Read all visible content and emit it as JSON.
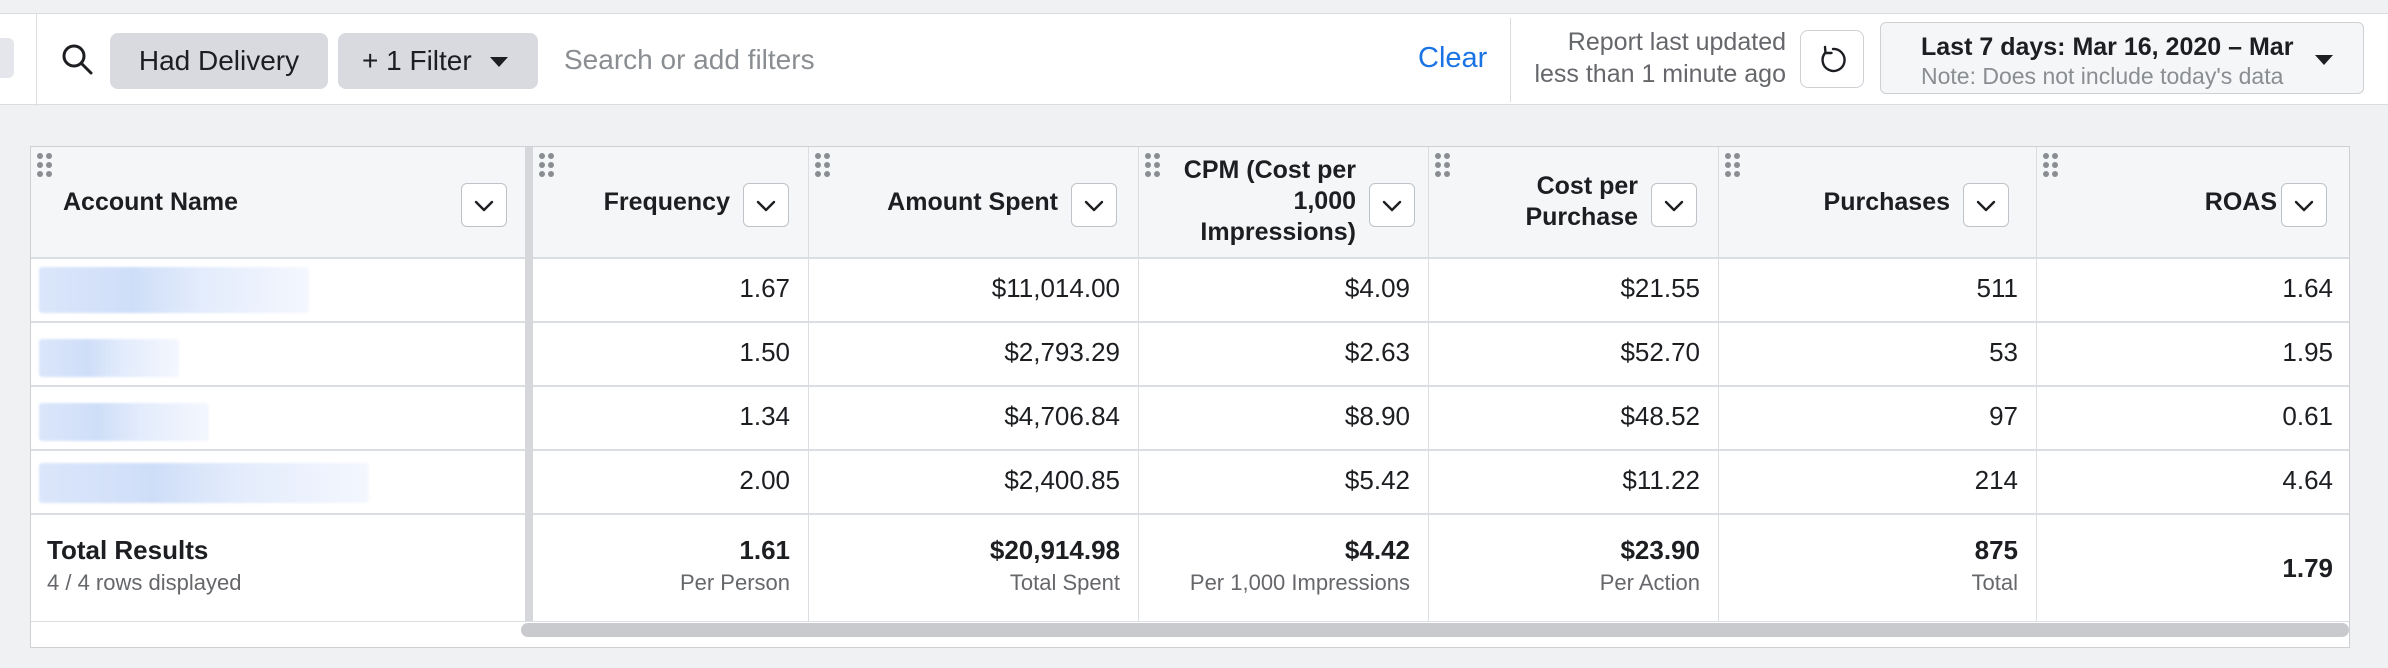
{
  "filterbar": {
    "chips": {
      "delivery": "Had Delivery",
      "filter": "+ 1 Filter"
    },
    "search_placeholder": "Search or add filters",
    "clear_label": "Clear",
    "updated_line1": "Report last updated",
    "updated_line2": "less than 1 minute ago",
    "date_line1": "Last 7 days: Mar 16, 2020 – Mar",
    "date_line2": "Note: Does not include today's data",
    "icons": [
      "search-icon",
      "refresh-icon",
      "chevron-down-icon"
    ]
  },
  "table": {
    "columns": [
      {
        "label": "Account Name"
      },
      {
        "label": "Frequency"
      },
      {
        "label": "Amount Spent"
      },
      {
        "label_lines": [
          "CPM (Cost per",
          "1,000",
          "Impressions)"
        ]
      },
      {
        "label_lines": [
          "Cost per",
          "Purchase"
        ]
      },
      {
        "label": "Purchases"
      },
      {
        "label": "ROAS"
      }
    ],
    "rows": [
      {
        "frequency": "1.67",
        "amount_spent": "$11,014.00",
        "cpm": "$4.09",
        "cost_per_purchase": "$21.55",
        "purchases": "511",
        "roas": "1.64"
      },
      {
        "frequency": "1.50",
        "amount_spent": "$2,793.29",
        "cpm": "$2.63",
        "cost_per_purchase": "$52.70",
        "purchases": "53",
        "roas": "1.95"
      },
      {
        "frequency": "1.34",
        "amount_spent": "$4,706.84",
        "cpm": "$8.90",
        "cost_per_purchase": "$48.52",
        "purchases": "97",
        "roas": "0.61"
      },
      {
        "frequency": "2.00",
        "amount_spent": "$2,400.85",
        "cpm": "$5.42",
        "cost_per_purchase": "$11.22",
        "purchases": "214",
        "roas": "4.64"
      }
    ],
    "totals": {
      "label": "Total Results",
      "rows_displayed": "4 / 4 rows displayed",
      "frequency": "1.61",
      "frequency_sub": "Per Person",
      "amount_spent": "$20,914.98",
      "amount_spent_sub": "Total Spent",
      "cpm": "$4.42",
      "cpm_sub": "Per 1,000 Impressions",
      "cost_per_purchase": "$23.90",
      "cost_per_purchase_sub": "Per Action",
      "purchases": "875",
      "purchases_sub": "Total",
      "roas": "1.79"
    }
  },
  "colors": {
    "accent": "#1b74e4",
    "chip_bg": "#d8dadf",
    "header_bg": "#f5f6f7"
  }
}
